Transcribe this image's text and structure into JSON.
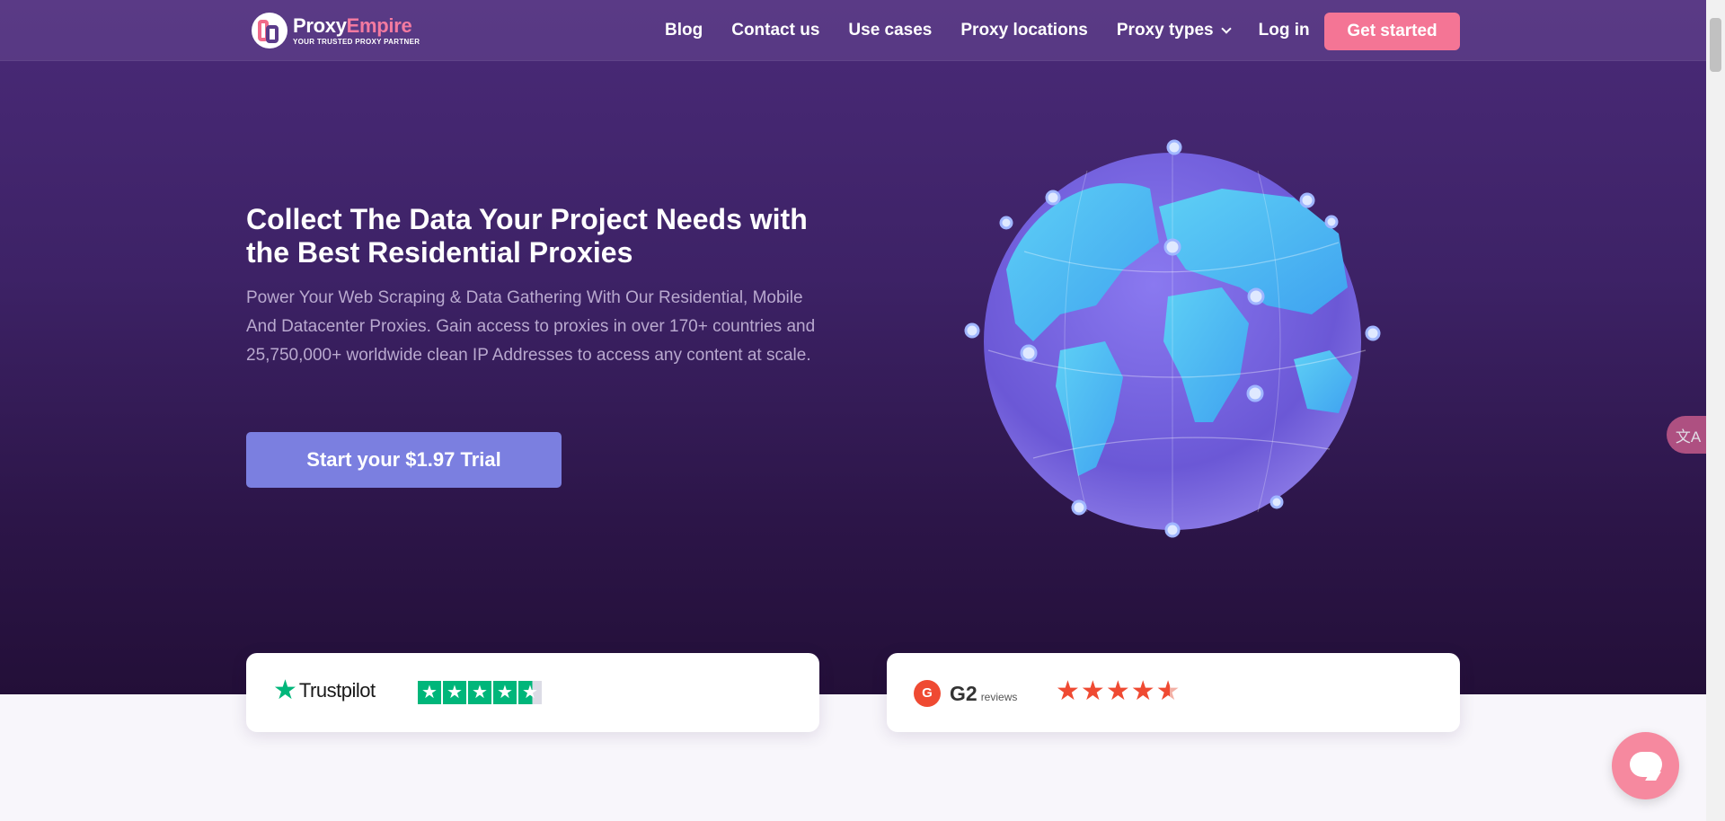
{
  "brand": {
    "name_part1": "Proxy",
    "name_part2": "Empire",
    "tagline": "YOUR TRUSTED PROXY PARTNER",
    "accent_color": "#f47595"
  },
  "nav": {
    "links": [
      "Blog",
      "Contact us",
      "Use cases",
      "Proxy locations",
      "Proxy types",
      "Log in"
    ],
    "cta": "Get started"
  },
  "hero": {
    "title": "Collect The Data Your Project Needs with the Best Residential Proxies",
    "subtitle": "Power Your Web Scraping & Data Gathering With Our Residential, Mobile And Datacenter Proxies. Gain access to proxies in over 170+ countries and 25,750,000+ worldwide clean IP Addresses to access any content at scale.",
    "cta": "Start your $1.97 Trial"
  },
  "reviews": {
    "trustpilot": {
      "label": "Trustpilot",
      "stars": 4.5
    },
    "g2": {
      "label": "G2",
      "sub": "reviews",
      "stars": 4.5
    }
  },
  "widgets": {
    "translate_icon": "translate-icon",
    "chat_icon": "chat-icon"
  }
}
